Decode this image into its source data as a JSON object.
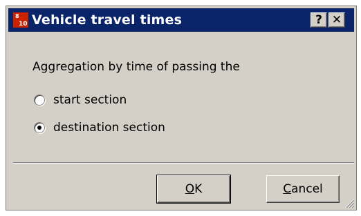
{
  "window": {
    "title": "Vehicle travel times",
    "help_glyph": "?",
    "close_glyph": "✕",
    "icon": "vehicle-travel-times-app-icon"
  },
  "content": {
    "prompt": "Aggregation by time of passing the",
    "options": [
      {
        "label": "start section",
        "selected": false
      },
      {
        "label": "destination section",
        "selected": true
      }
    ]
  },
  "buttons": {
    "ok": {
      "mnemonic": "O",
      "rest": "K"
    },
    "cancel": {
      "mnemonic": "C",
      "rest": "ancel"
    }
  },
  "colors": {
    "titlebar": "#0a246a",
    "face": "#d4d0c8",
    "icon_red": "#cc2200"
  }
}
